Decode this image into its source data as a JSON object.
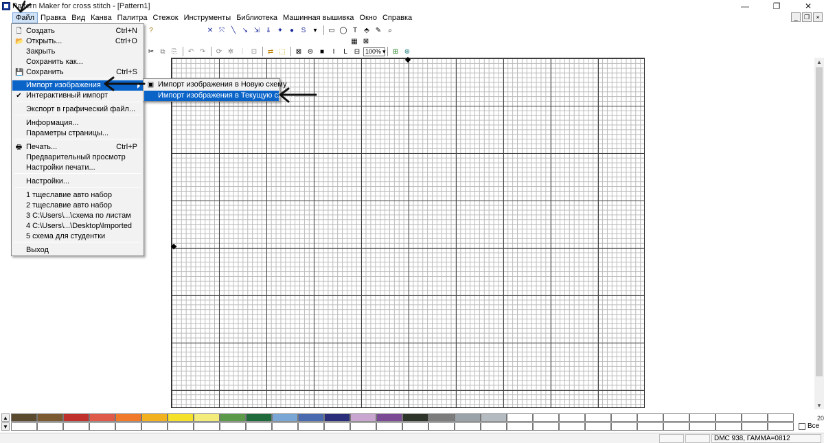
{
  "window": {
    "title": "Pattern Maker for cross stitch - [Pattern1]",
    "minimize_glyph": "—",
    "maximize_glyph": "❐",
    "close_glyph": "✕"
  },
  "menubar": {
    "items": [
      "Файл",
      "Правка",
      "Вид",
      "Канва",
      "Палитра",
      "Стежок",
      "Инструменты",
      "Библиотека",
      "Машинная вышивка",
      "Окно",
      "Справка"
    ],
    "active_index": 0
  },
  "file_menu": {
    "items": [
      {
        "label": "Создать",
        "shortcut": "Ctrl+N",
        "icon": "new-document-icon"
      },
      {
        "label": "Открыть...",
        "shortcut": "Ctrl+O",
        "icon": "open-folder-icon"
      },
      {
        "label": "Закрыть",
        "shortcut": "",
        "icon": ""
      },
      {
        "label": "Сохранить как...",
        "shortcut": "",
        "icon": ""
      },
      {
        "label": "Сохранить",
        "shortcut": "Ctrl+S",
        "icon": "save-disk-icon"
      },
      {
        "label": "Импорт изображения",
        "shortcut": "",
        "icon": "",
        "highlighted": true,
        "has_submenu": true
      },
      {
        "label": "Интерактивный импорт",
        "shortcut": "",
        "icon": "checkmark-icon",
        "checked": true
      },
      {
        "label": "Экспорт в графический файл...",
        "shortcut": "",
        "icon": ""
      },
      {
        "label": "Информация...",
        "shortcut": "",
        "icon": ""
      },
      {
        "label": "Параметры страницы...",
        "shortcut": "",
        "icon": ""
      },
      {
        "label": "Печать...",
        "shortcut": "Ctrl+P",
        "icon": "printer-icon"
      },
      {
        "label": "Предварительный просмотр",
        "shortcut": "",
        "icon": ""
      },
      {
        "label": "Настройки печати...",
        "shortcut": "",
        "icon": ""
      },
      {
        "label": "Настройки...",
        "shortcut": "",
        "icon": ""
      },
      {
        "label": "1 тщеславие авто набор",
        "shortcut": "",
        "icon": ""
      },
      {
        "label": "2 тщеславие авто набор",
        "shortcut": "",
        "icon": ""
      },
      {
        "label": "3 C:\\Users\\...\\схема по листам",
        "shortcut": "",
        "icon": ""
      },
      {
        "label": "4 C:\\Users\\...\\Desktop\\Imported",
        "shortcut": "",
        "icon": ""
      },
      {
        "label": "5 схема для студентки",
        "shortcut": "",
        "icon": ""
      },
      {
        "label": "Выход",
        "shortcut": "",
        "icon": ""
      }
    ]
  },
  "import_submenu": {
    "items": [
      {
        "label": "Импорт изображения в Новую схему",
        "icon": "import-image-icon"
      },
      {
        "label": "Импорт изображения в Текущую схему",
        "highlighted": true
      }
    ]
  },
  "toolbar": {
    "zoom_value": "100%",
    "zoom_arrow": "▾"
  },
  "palette": {
    "colors": [
      "#5a4a2e",
      "#7b5a32",
      "#c0302c",
      "#e05a4a",
      "#f07a2a",
      "#f2b11e",
      "#f5e02a",
      "#f4ec7a",
      "#5a9a48",
      "#1e6a3a",
      "#7aa6d6",
      "#4a6ab0",
      "#2a2e7a",
      "#c9a6cf",
      "#7a4a94",
      "#2e342a",
      "#7c7c7c",
      "#9aa2aa",
      "#b4bcc2",
      "#ffffff",
      "#ffffff",
      "#ffffff",
      "#ffffff",
      "#ffffff",
      "#ffffff",
      "#ffffff",
      "#ffffff",
      "#ffffff",
      "#ffffff",
      "#ffffff"
    ],
    "page_number": "20",
    "all_checkbox_label": "Все"
  },
  "statusbar": {
    "color_info": "DMC  938, ГАММА=0812"
  }
}
